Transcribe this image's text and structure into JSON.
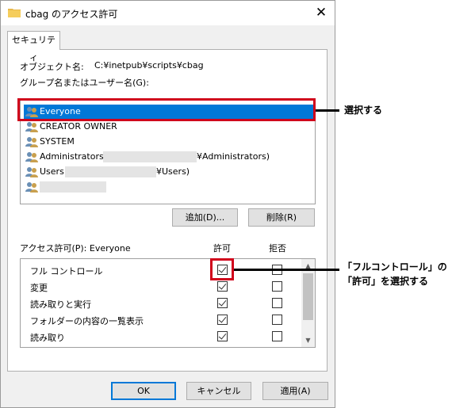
{
  "window": {
    "title": "cbag のアクセス許可",
    "close_glyph": "✕"
  },
  "tab": {
    "label": "セキュリティ"
  },
  "object": {
    "label": "オブジェクト名:",
    "value": "C:¥inetpub¥scripts¥cbag"
  },
  "group_list": {
    "label": "グループ名またはユーザー名(G):",
    "items": [
      {
        "name": "Everyone",
        "selected": true,
        "icon": "users-icon"
      },
      {
        "name": "CREATOR OWNER",
        "selected": false,
        "icon": "users-icon"
      },
      {
        "name": "SYSTEM",
        "selected": false,
        "icon": "users-icon"
      },
      {
        "name": "Administrators",
        "suffix": "¥Administrators)",
        "selected": false,
        "icon": "users-icon"
      },
      {
        "name": "Users",
        "suffix": "¥Users)",
        "selected": false,
        "icon": "users-icon"
      },
      {
        "name": "",
        "selected": false,
        "icon": "user-icon"
      }
    ]
  },
  "buttons": {
    "add": "追加(D)...",
    "remove": "削除(R)",
    "ok": "OK",
    "cancel": "キャンセル",
    "apply": "適用(A)"
  },
  "permissions": {
    "label": "アクセス許可(P): Everyone",
    "allow_header": "許可",
    "deny_header": "拒否",
    "rows": [
      {
        "name": "フル コントロール",
        "allow": true,
        "deny": false
      },
      {
        "name": "変更",
        "allow": true,
        "deny": false
      },
      {
        "name": "読み取りと実行",
        "allow": true,
        "deny": false
      },
      {
        "name": "フォルダーの内容の一覧表示",
        "allow": true,
        "deny": false
      },
      {
        "name": "読み取り",
        "allow": true,
        "deny": false
      }
    ]
  },
  "callouts": {
    "select": "選択する",
    "allow_line1": "「フルコントロール」の",
    "allow_line2": "「許可」を選択する",
    "color": "#d0021b"
  },
  "colors": {
    "selection": "#0078d7",
    "highlight": "#d0021b"
  }
}
